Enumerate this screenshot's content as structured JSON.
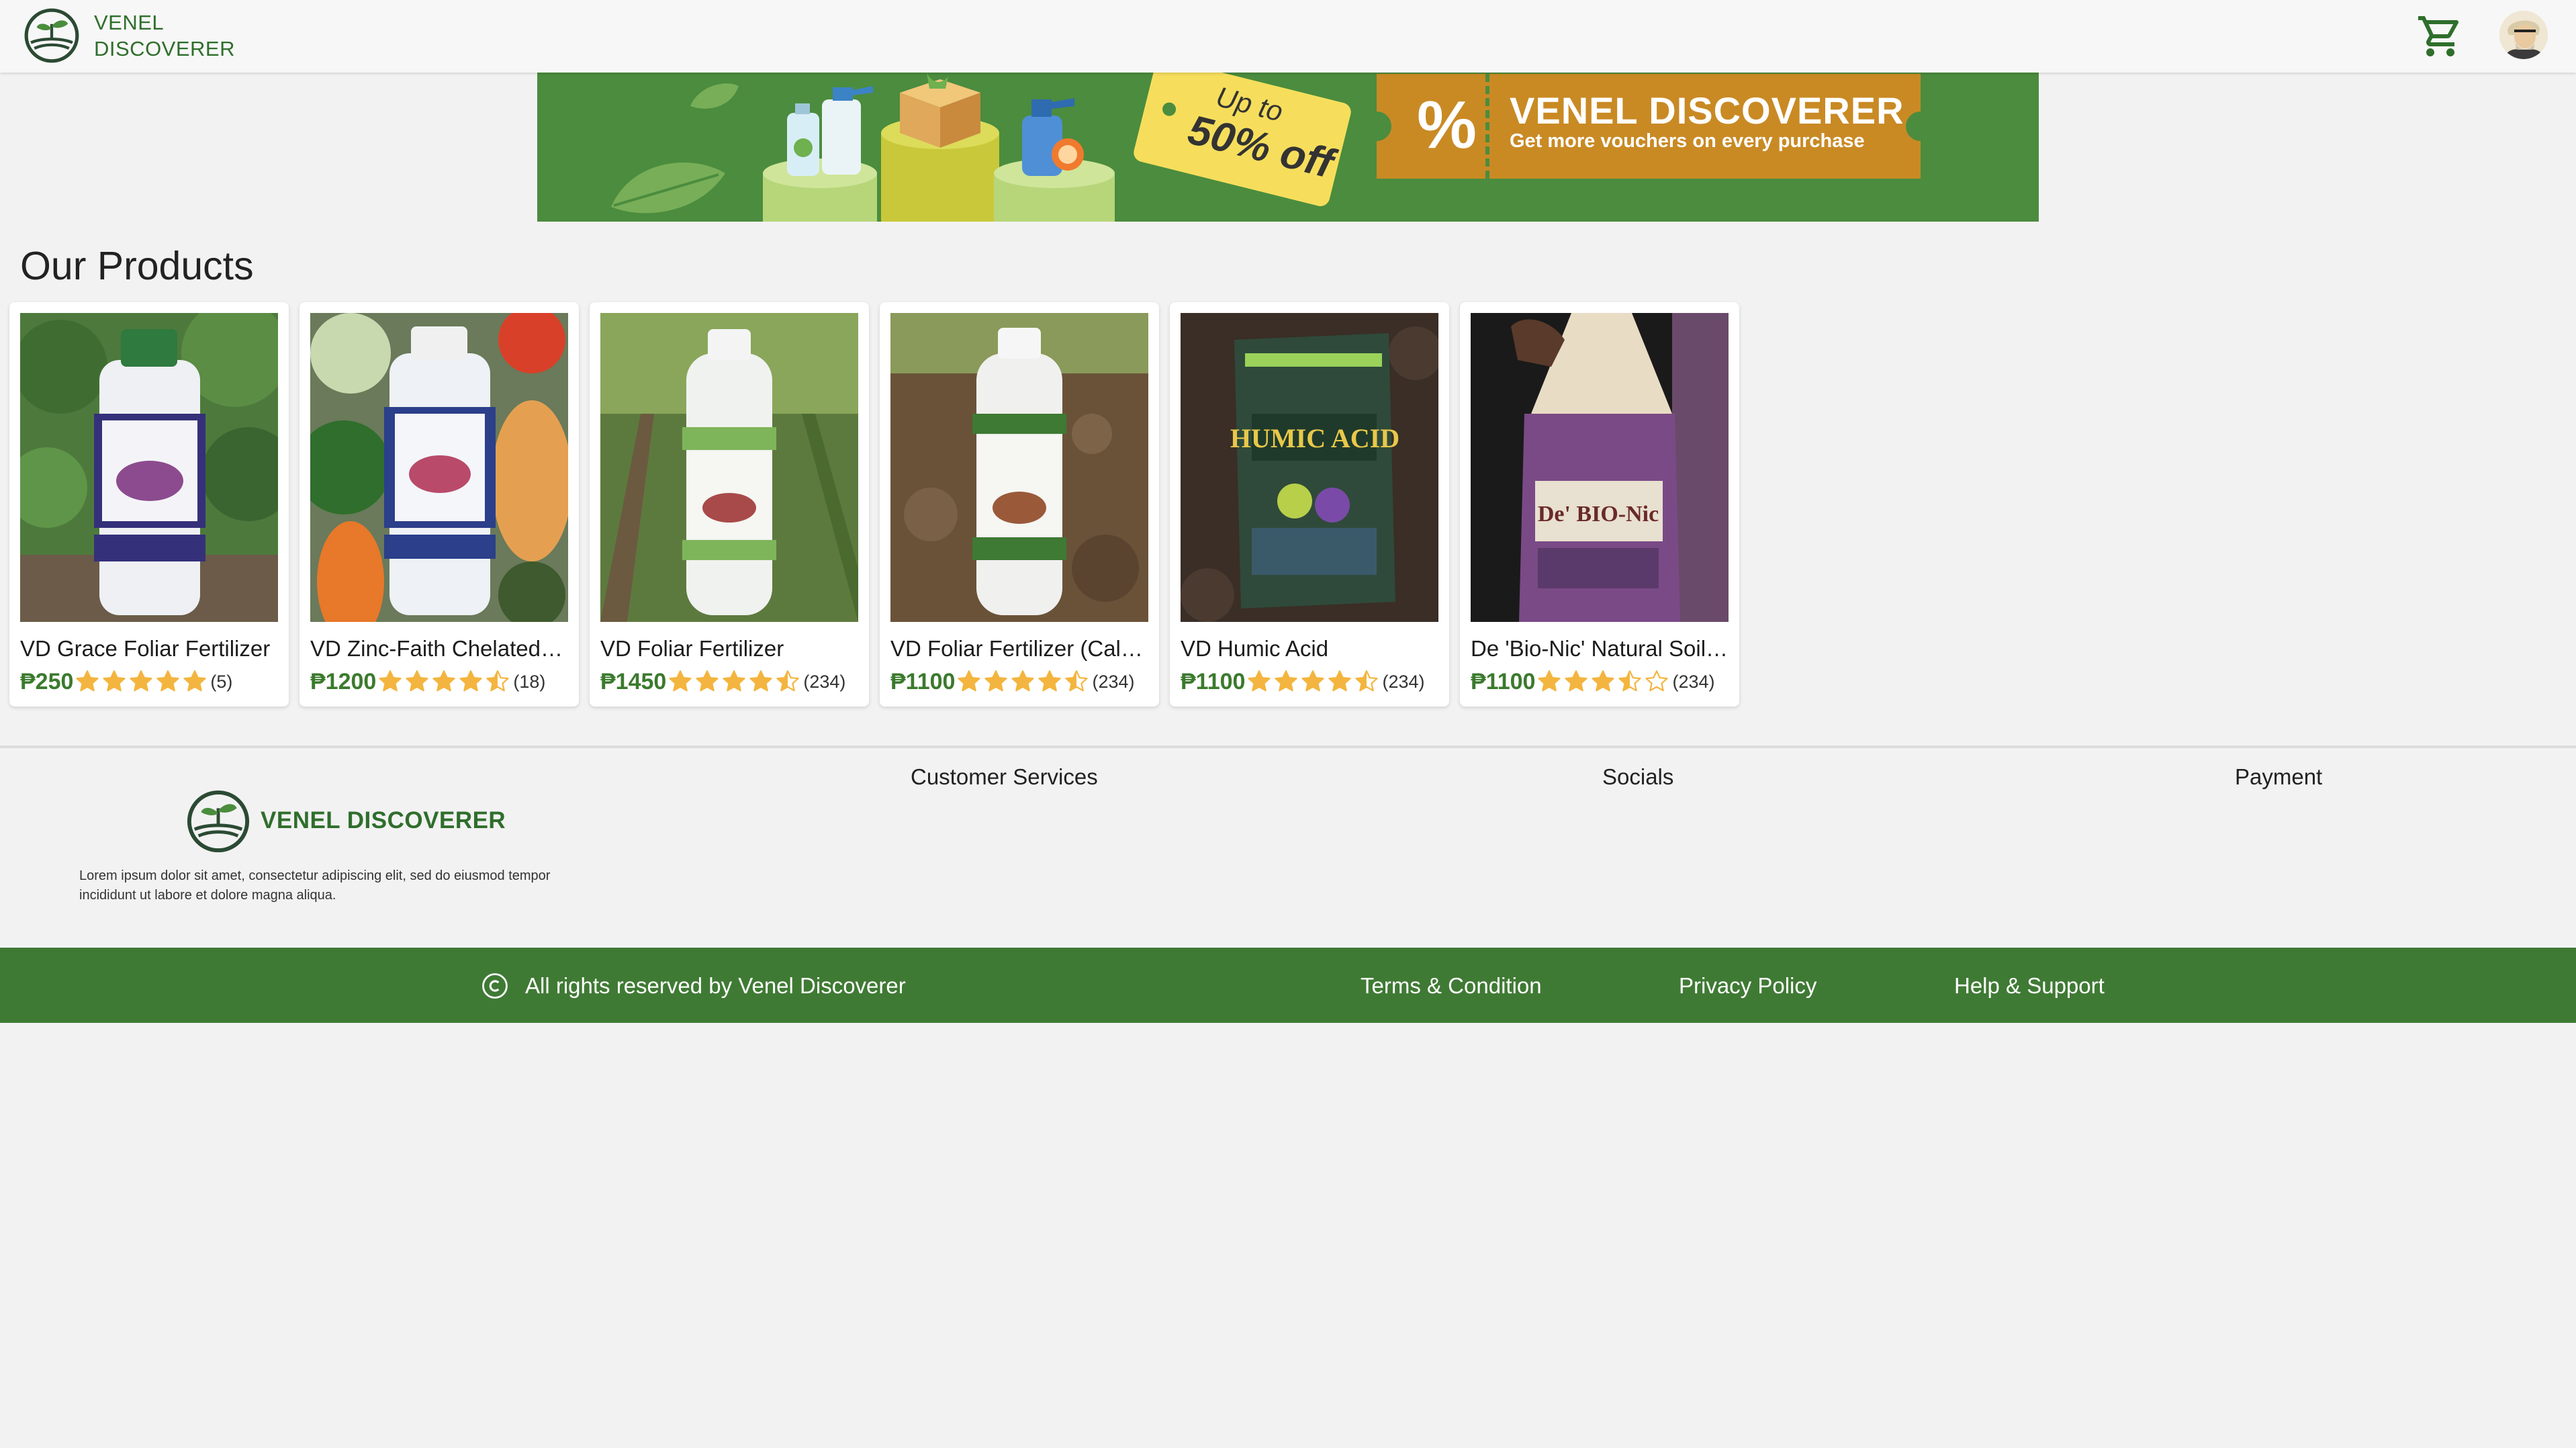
{
  "header": {
    "brand_line1": "VENEL",
    "brand_line2": "DISCOVERER",
    "cart_icon": "cart-icon",
    "avatar_icon": "user-avatar"
  },
  "banner": {
    "tag_up_to": "Up to",
    "tag_discount": "50% off",
    "voucher_symbol": "%",
    "voucher_title": "VENEL DISCOVERER",
    "voucher_subtitle": "Get more vouchers on every purchase"
  },
  "products": {
    "title": "Our Products",
    "items": [
      {
        "name": "VD Grace Foliar Fertilizer",
        "price": "₱250",
        "rating": 5,
        "count": "(5)"
      },
      {
        "name": "VD Zinc-Faith Chelated Zinc",
        "price": "₱1200",
        "rating": 4.5,
        "count": "(18)"
      },
      {
        "name": "VD Foliar Fertilizer",
        "price": "₱1450",
        "rating": 4.5,
        "count": "(234)"
      },
      {
        "name": "VD Foliar Fertilizer (Calcium)",
        "price": "₱1100",
        "rating": 4.5,
        "count": "(234)"
      },
      {
        "name": "VD Humic Acid",
        "price": "₱1100",
        "rating": 4.5,
        "count": "(234)"
      },
      {
        "name": "De 'Bio-Nic' Natural Soil Conditioner",
        "price": "₱1100",
        "rating": 3.5,
        "count": "(234)"
      }
    ]
  },
  "footer": {
    "brand": "VENEL DISCOVERER",
    "description": "Lorem ipsum dolor sit amet, consectetur adipiscing elit, sed do eiusmod tempor incididunt ut labore et dolore magna aliqua.",
    "columns": [
      "Customer Services",
      "Socials",
      "Payment"
    ],
    "copyright": "All rights reserved by Venel Discoverer",
    "links": [
      "Terms & Condition",
      "Privacy Policy",
      "Help & Support"
    ]
  },
  "colors": {
    "brand_green": "#2f6e2c",
    "footer_bar": "#3f7a34",
    "star": "#f3b53f",
    "voucher": "#c98a24"
  }
}
